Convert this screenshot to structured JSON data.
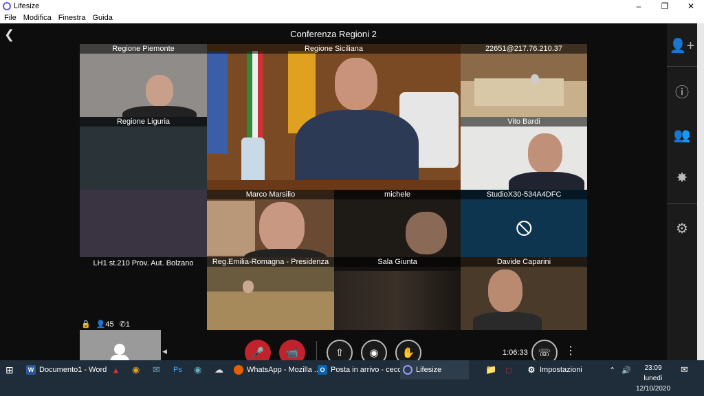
{
  "window": {
    "title": "Lifesize",
    "menu": [
      "File",
      "Modifica",
      "Finestra",
      "Guida"
    ],
    "controls": {
      "minimize": "–",
      "restore": "❐",
      "close": "✕"
    }
  },
  "conference": {
    "title": "Conferenza Regioni 2",
    "participants_count": "45",
    "phone_count": "1",
    "elapsed_time": "1:06:33"
  },
  "tiles": [
    {
      "name": "Regione Piemonte"
    },
    {
      "name": "Regione Siciliana"
    },
    {
      "name": "22651@217.76.210.37"
    },
    {
      "name": "Regione Liguria"
    },
    {
      "name": "Vito Bardi"
    },
    {
      "name": "Marco Marsilio"
    },
    {
      "name": "michele"
    },
    {
      "name": "StudioX30-534A4DFC"
    },
    {
      "name": "LH1 st.210 Prov. Aut. Bolzano"
    },
    {
      "name": "Reg.Emilia-Romagna - Presidenza"
    },
    {
      "name": "Sala Giunta"
    },
    {
      "name": "Davide Caparini"
    }
  ],
  "rightbar": {
    "icons": [
      "add-participant-icon",
      "info-icon",
      "participants-icon",
      "settings-effects-icon",
      "gear-icon"
    ]
  },
  "controls": {
    "mute": "mute-microphone-icon",
    "video": "video-off-icon",
    "share": "share-icon",
    "record": "record-icon",
    "raise_hand": "raise-hand-icon",
    "hangup": "hangup-icon"
  },
  "taskbar": {
    "items": [
      {
        "label": "Documento1 - Word",
        "icon": "word-icon",
        "color": "#2b5797"
      },
      {
        "label": "WhatsApp - Mozilla ...",
        "icon": "firefox-icon",
        "color": "#e66000"
      },
      {
        "label": "Posta in arrivo - cecc...",
        "icon": "outlook-icon",
        "color": "#0a64ad"
      },
      {
        "label": "Lifesize",
        "icon": "lifesize-icon",
        "color": "#5b5bd6"
      },
      {
        "label": "Impostazioni",
        "icon": "gear-icon",
        "color": "#555"
      }
    ],
    "clock": {
      "time": "23:09",
      "day": "lunedì",
      "date": "12/10/2020"
    }
  }
}
